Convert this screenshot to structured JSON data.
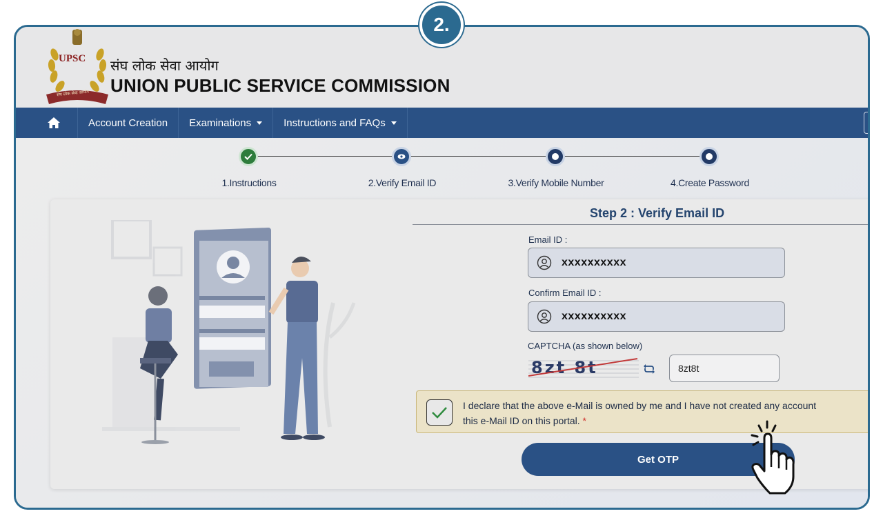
{
  "badge": "2.",
  "header": {
    "logo_text": "UPSC",
    "logo_ribbon": "संघ लोक सेवा आयोग",
    "hindi_title": "संघ लोक सेवा आयोग",
    "english_title": "UNION PUBLIC SERVICE COMMISSION"
  },
  "nav": {
    "home_icon": "home-icon",
    "items": [
      {
        "label": "Account Creation",
        "has_dropdown": false
      },
      {
        "label": "Examinations",
        "has_dropdown": true
      },
      {
        "label": "Instructions and FAQs",
        "has_dropdown": true
      }
    ]
  },
  "stepper": {
    "steps": [
      {
        "label": "1.Instructions",
        "state": "done"
      },
      {
        "label": "2.Verify Email ID",
        "state": "active"
      },
      {
        "label": "3.Verify Mobile Number",
        "state": "pending"
      },
      {
        "label": "4.Create Password",
        "state": "pending"
      }
    ]
  },
  "form": {
    "title": "Step 2 : Verify Email ID",
    "email_label": "Email ID :",
    "email_value": "xxxxxxxxxx",
    "confirm_email_label": "Confirm Email ID :",
    "confirm_email_value": "xxxxxxxxxx",
    "captcha_label": "CAPTCHA (as shown below)",
    "captcha_image_text": "8zt 8t",
    "captcha_value": "8zt8t",
    "declaration_line1": "I declare that the above e-Mail is owned by me and I have not created any account",
    "declaration_line2": "this e-Mail ID on this portal.",
    "required_mark": "*",
    "declaration_checked": true,
    "submit_label": "Get OTP"
  },
  "colors": {
    "frame": "#2b6a90",
    "navbar": "#2a5185",
    "step_done": "#2e7d3c",
    "declaration_bg": "#ebe3c8",
    "button": "#2a5185"
  }
}
